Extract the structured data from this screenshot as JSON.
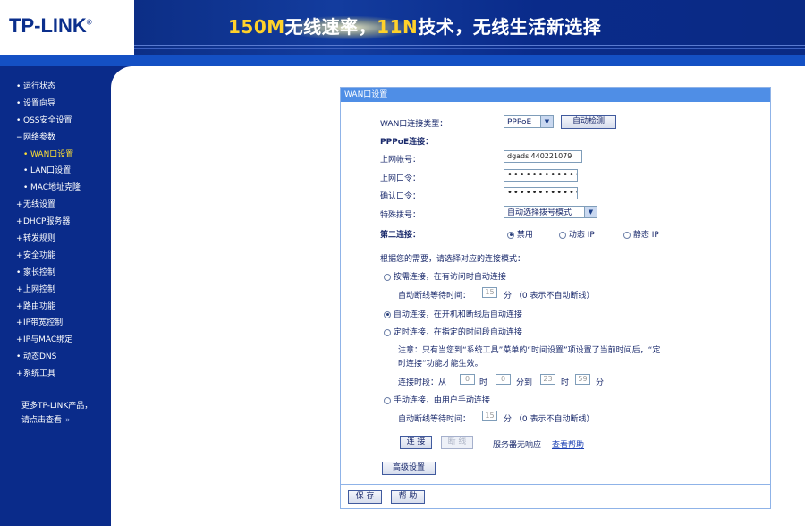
{
  "banner": {
    "logo": "TP-LINK",
    "logo_mark": "®",
    "slogan_hl1": "150M",
    "slogan_p1": "无线速率，",
    "slogan_hl2": "11N",
    "slogan_p2": "技术，无线生活新选择"
  },
  "sidebar": {
    "items": [
      {
        "label": "运行状态",
        "bullet": "•"
      },
      {
        "label": "设置向导",
        "bullet": "•"
      },
      {
        "label": "QSS安全设置",
        "bullet": "•"
      },
      {
        "label": "网络参数",
        "bullet": "−"
      },
      {
        "label": "WAN口设置",
        "bullet": "•"
      },
      {
        "label": "LAN口设置",
        "bullet": "•"
      },
      {
        "label": "MAC地址克隆",
        "bullet": "•"
      },
      {
        "label": "无线设置",
        "bullet": "+"
      },
      {
        "label": "DHCP服务器",
        "bullet": "+"
      },
      {
        "label": "转发规则",
        "bullet": "+"
      },
      {
        "label": "安全功能",
        "bullet": "+"
      },
      {
        "label": "家长控制",
        "bullet": "•"
      },
      {
        "label": "上网控制",
        "bullet": "+"
      },
      {
        "label": "路由功能",
        "bullet": "+"
      },
      {
        "label": "IP带宽控制",
        "bullet": "+"
      },
      {
        "label": "IP与MAC绑定",
        "bullet": "+"
      },
      {
        "label": "动态DNS",
        "bullet": "•"
      },
      {
        "label": "系统工具",
        "bullet": "+"
      }
    ],
    "more_line1": "更多TP-LINK产品，",
    "more_line2": "请点击查看",
    "more_arrow": "»"
  },
  "panel": {
    "title": "WAN口设置",
    "conn_type_label": "WAN口连接类型：",
    "conn_type_value": "PPPoE",
    "auto_detect": "自动检测",
    "pppoe_label": "PPPoE连接：",
    "account_label": "上网帐号：",
    "account_value": "dgadsl440221079",
    "password_label": "上网口令：",
    "password_value": "•••••••••••••••",
    "confirm_label": "确认口令：",
    "confirm_value": "•••••••••••••••",
    "dial_label": "特殊拨号：",
    "dial_value": "自动选择拨号模式",
    "second_label": "第二连接：",
    "second_options": [
      "禁用",
      "动态 IP",
      "静态 IP"
    ],
    "mode_prompt": "根据您的需要，请选择对应的连接模式：",
    "mode1": "按需连接，在有访问时自动连接",
    "idle_label": "自动断线等待时间：",
    "idle_value": "15",
    "idle_unit": "分 （0 表示不自动断线）",
    "mode2": "自动连接，在开机和断线后自动连接",
    "mode3": "定时连接，在指定的时间段自动连接",
    "note1": "注意：只有当您到“系统工具”菜单的“时间设置”项设置了当前时间后，“定",
    "note2": "时连接”功能才能生效。",
    "period_label": "连接时段：从",
    "t1": "0",
    "t1_unit": "时",
    "t2": "0",
    "t2_unit": "分到",
    "t3": "23",
    "t3_unit": "时",
    "t4": "59",
    "t4_unit": "分",
    "mode4": "手动连接，由用户手动连接",
    "idle2_value": "15",
    "connect": "连 接",
    "disconnect": "断 线",
    "status": "服务器无响应",
    "help": "查看帮助",
    "advanced": "高级设置",
    "save": "保 存",
    "helpbtn": "帮 助"
  }
}
